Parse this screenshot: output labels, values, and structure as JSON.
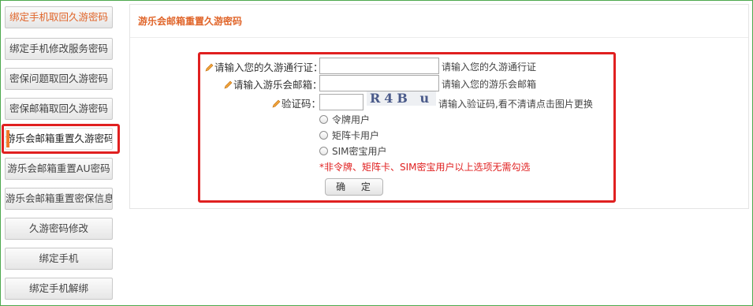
{
  "sidebar": {
    "items": [
      {
        "label": "绑定手机取回久游密码"
      },
      {
        "label": "绑定手机修改服务密码"
      },
      {
        "label": "密保问题取回久游密码"
      },
      {
        "label": "密保邮箱取回久游密码"
      },
      {
        "label": "游乐会邮箱重置久游密码"
      },
      {
        "label": "游乐会邮箱重置AU密码"
      },
      {
        "label": "游乐会邮箱重置密保信息"
      },
      {
        "label": "久游密码修改"
      },
      {
        "label": "绑定手机"
      },
      {
        "label": "绑定手机解绑"
      }
    ]
  },
  "panel": {
    "title": "游乐会邮箱重置久游密码"
  },
  "form": {
    "account_label": "请输入您的久游通行证：",
    "account_value": "",
    "account_hint": "请输入您的久游通行证",
    "email_label": "请输入游乐会邮箱：",
    "email_value": "",
    "email_hint": "请输入您的游乐会邮箱",
    "captcha_label": "验证码：",
    "captcha_value": "",
    "captcha_image_text": "R4B u",
    "captcha_hint": "请输入验证码,看不清请点击图片更换",
    "options": [
      {
        "label": "令牌用户"
      },
      {
        "label": "矩阵卡用户"
      },
      {
        "label": "SIM密宝用户"
      }
    ],
    "note": "*非令牌、矩阵卡、SIM密宝用户以上选项无需勾选",
    "submit_label": "确 定"
  },
  "colors": {
    "accent": "#e0652a",
    "highlight_border": "#e02020",
    "frame_border": "#4da84d"
  }
}
